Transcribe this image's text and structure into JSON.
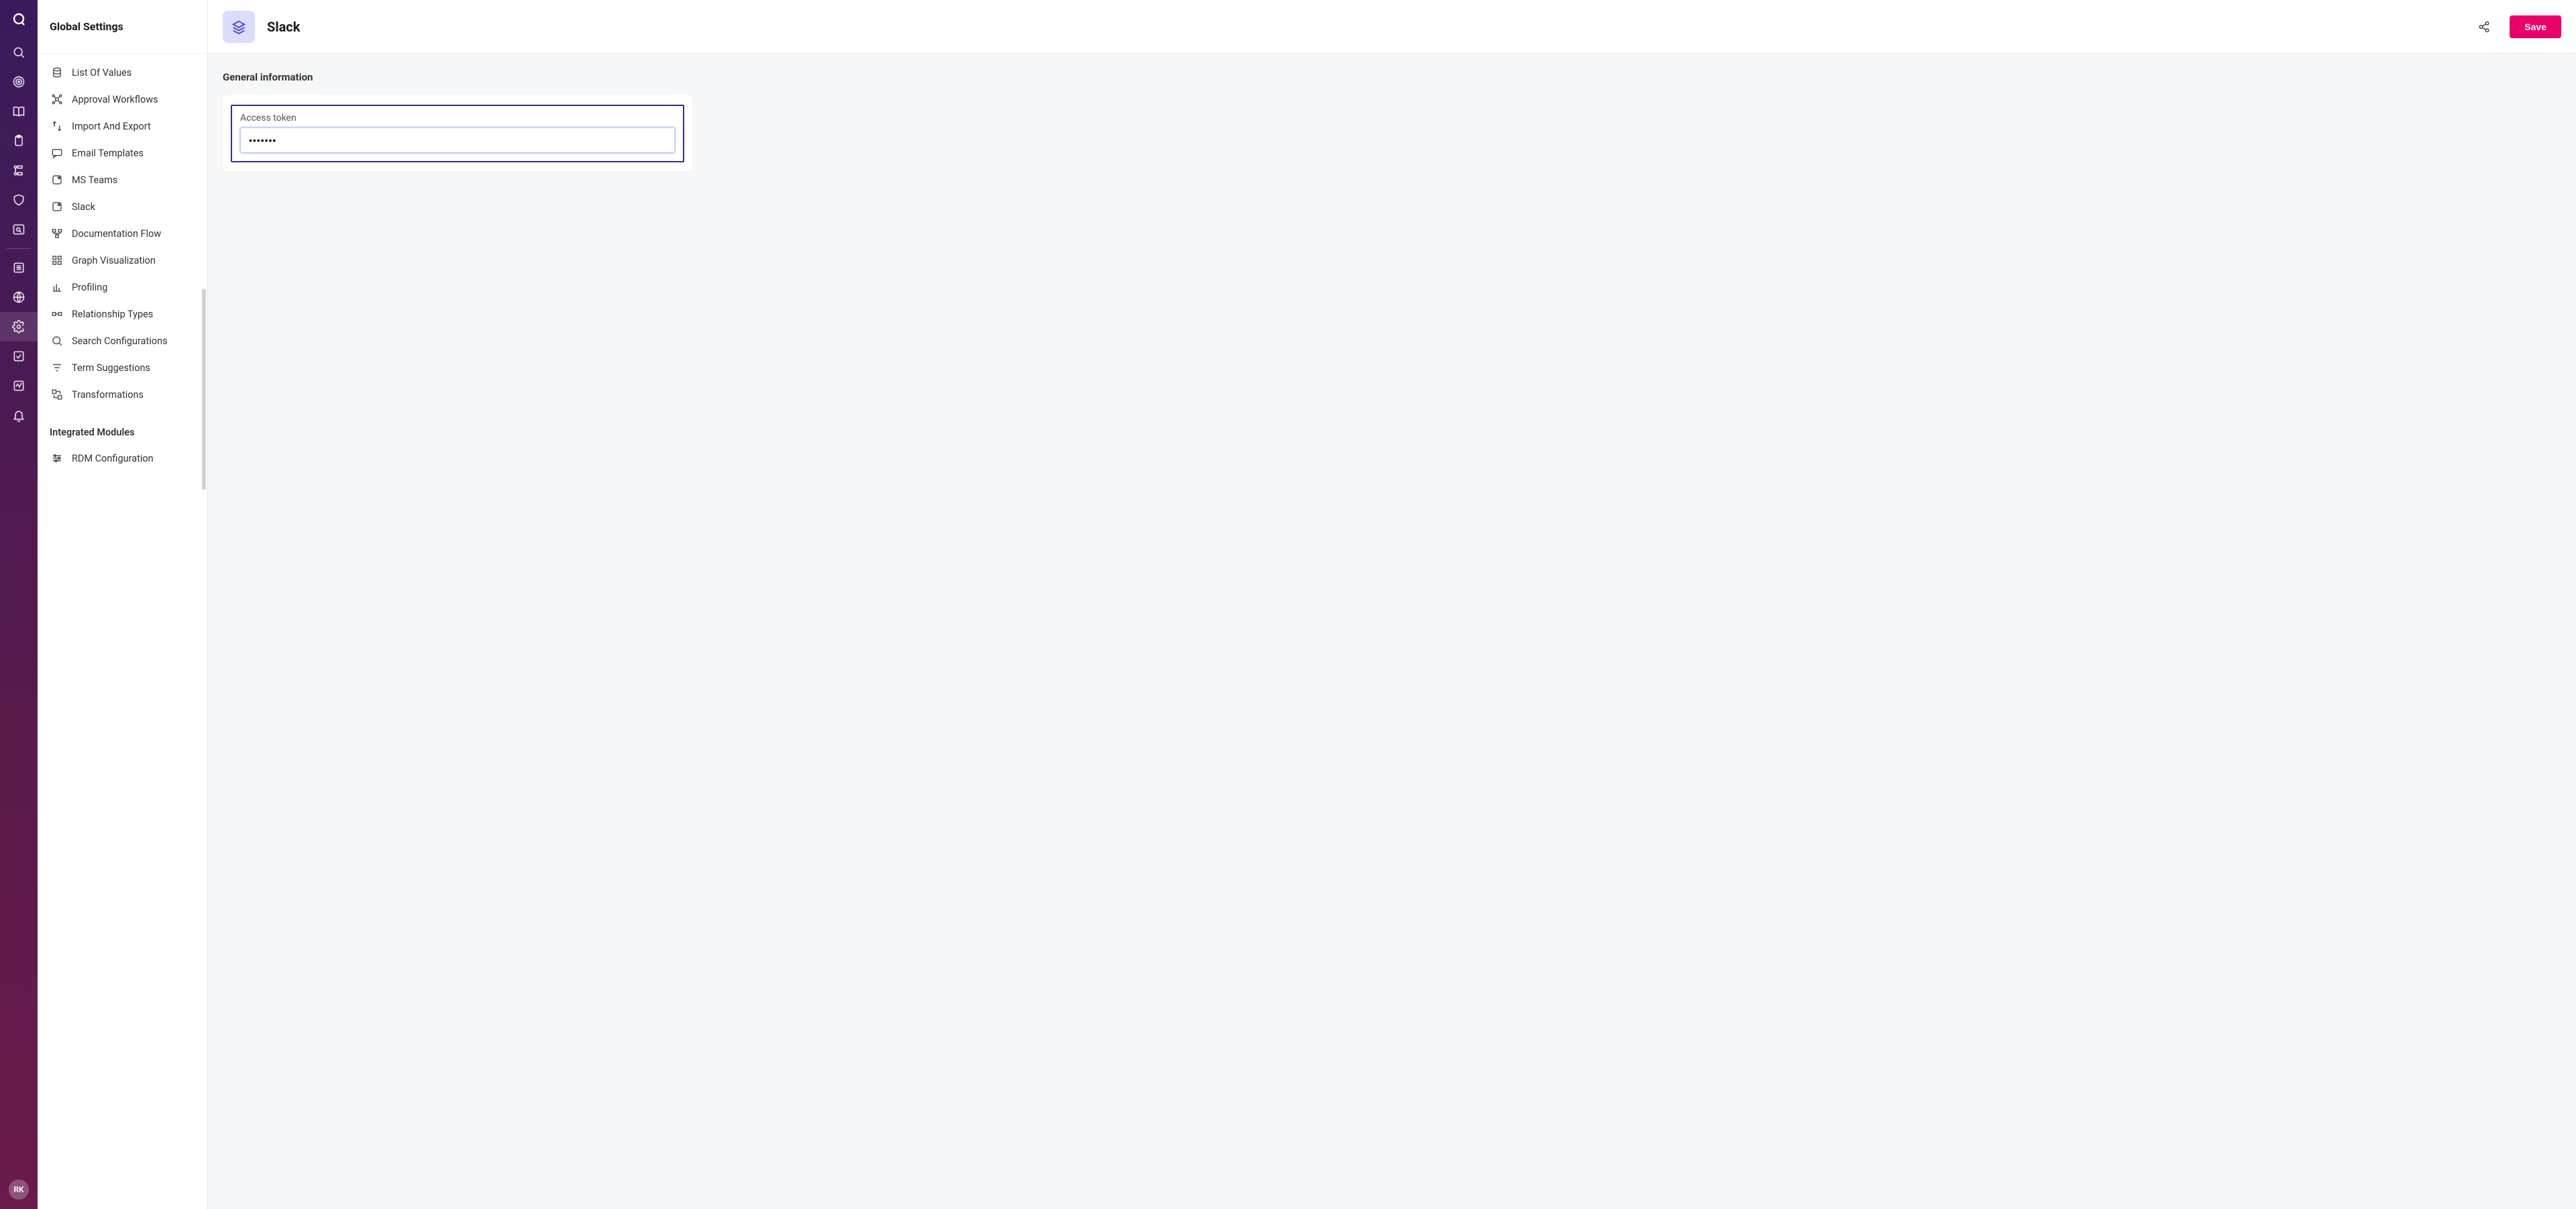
{
  "rail": {
    "avatar_initials": "RK"
  },
  "sidebar": {
    "title": "Global Settings",
    "items": [
      {
        "label": "List Of Values",
        "icon": "database"
      },
      {
        "label": "Approval Workflows",
        "icon": "workflow"
      },
      {
        "label": "Import And Export",
        "icon": "import-export"
      },
      {
        "label": "Email Templates",
        "icon": "message"
      },
      {
        "label": "MS Teams",
        "icon": "teams"
      },
      {
        "label": "Slack",
        "icon": "slack"
      },
      {
        "label": "Documentation Flow",
        "icon": "flow"
      },
      {
        "label": "Graph Visualization",
        "icon": "grid"
      },
      {
        "label": "Profiling",
        "icon": "bar"
      },
      {
        "label": "Relationship Types",
        "icon": "relationship"
      },
      {
        "label": "Search Configurations",
        "icon": "search"
      },
      {
        "label": "Term Suggestions",
        "icon": "filter"
      },
      {
        "label": "Transformations",
        "icon": "transform"
      }
    ],
    "section_header": "Integrated Modules",
    "integrated_items": [
      {
        "label": "RDM Configuration",
        "icon": "sliders"
      }
    ]
  },
  "header": {
    "title": "Slack",
    "save_label": "Save"
  },
  "content": {
    "section_title": "General information",
    "access_token_label": "Access token",
    "access_token_value": "•••••••"
  }
}
